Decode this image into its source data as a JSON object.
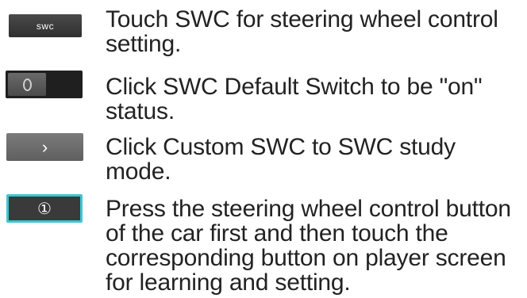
{
  "steps": [
    {
      "control_label": "SWC",
      "control_icon": "swc-button",
      "text": "Touch SWC for steering wheel control setting."
    },
    {
      "control_label": "",
      "control_icon": "toggle-switch-off-icon",
      "text": "Click SWC Default Switch to be \"on\" status."
    },
    {
      "control_label": "›",
      "control_icon": "chevron-right-icon",
      "text": "Click Custom SWC to SWC study mode."
    },
    {
      "control_label": "①",
      "control_icon": "numbered-key-button",
      "text": "Press the steering wheel control button of the car first and then touch the corresponding button on player screen for learning and setting."
    }
  ],
  "colors": {
    "text": "#222222",
    "button_dark": "#3a3a3a",
    "button_highlight_border": "#41c4d4",
    "button_gray": "#6e6e6e"
  }
}
